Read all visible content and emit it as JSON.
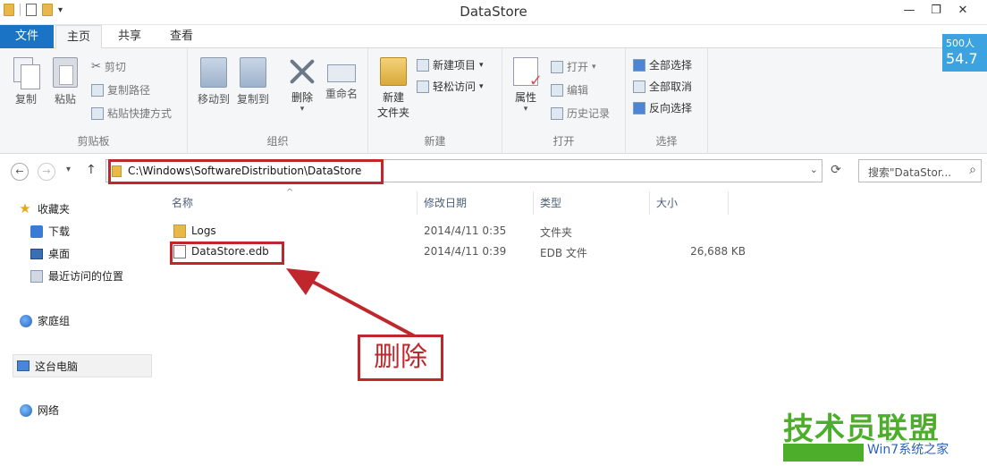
{
  "window": {
    "title": "DataStore",
    "controls": [
      "—",
      "❐",
      "✕"
    ]
  },
  "tabs": [
    {
      "label": "文件"
    },
    {
      "label": "主页"
    },
    {
      "label": "共享"
    },
    {
      "label": "查看"
    }
  ],
  "ribbon": {
    "clipboard": {
      "label": "剪贴板",
      "copy": "复制",
      "paste": "粘贴",
      "cut": "剪切",
      "copy_path": "复制路径",
      "paste_shortcut": "粘贴快捷方式"
    },
    "organize": {
      "label": "组织",
      "move_to": "移动到",
      "copy_to": "复制到",
      "delete": "删除",
      "rename": "重命名"
    },
    "new": {
      "label": "新建",
      "new_folder_line1": "新建",
      "new_folder_line2": "文件夹",
      "new_item": "新建项目",
      "easy_access": "轻松访问"
    },
    "open": {
      "label": "打开",
      "properties": "属性",
      "open": "打开",
      "edit": "编辑",
      "history": "历史记录"
    },
    "select": {
      "label": "选择",
      "select_all": "全部选择",
      "select_none": "全部取消",
      "invert": "反向选择"
    }
  },
  "address": {
    "path": "C:\\Windows\\SoftwareDistribution\\DataStore",
    "search_placeholder": "搜索\"DataStor...",
    "back": "←",
    "forward": "→",
    "up": "↑",
    "refresh": "⟳"
  },
  "navpane": {
    "favorites": "收藏夹",
    "downloads": "下载",
    "desktop": "桌面",
    "recent": "最近访问的位置",
    "homegroup": "家庭组",
    "this_pc": "这台电脑",
    "network": "网络"
  },
  "columns": {
    "name": "名称",
    "modified": "修改日期",
    "type": "类型",
    "size": "大小"
  },
  "files": [
    {
      "name": "Logs",
      "modified": "2014/4/11 0:35",
      "type": "文件夹",
      "size": ""
    },
    {
      "name": "DataStore.edb",
      "modified": "2014/4/11 0:39",
      "type": "EDB 文件",
      "size": "26,688 KB"
    }
  ],
  "annotation": {
    "text": "删除",
    "color": "#c0272d"
  },
  "overlay": {
    "line1": "500人",
    "line2": "54.7"
  },
  "watermark": {
    "main": "技术员联盟",
    "sub": "Win7系统之家"
  },
  "colors": {
    "file_tab": "#1a73c4",
    "highlight": "#c0272d",
    "watermark_green": "#4cae2a"
  }
}
